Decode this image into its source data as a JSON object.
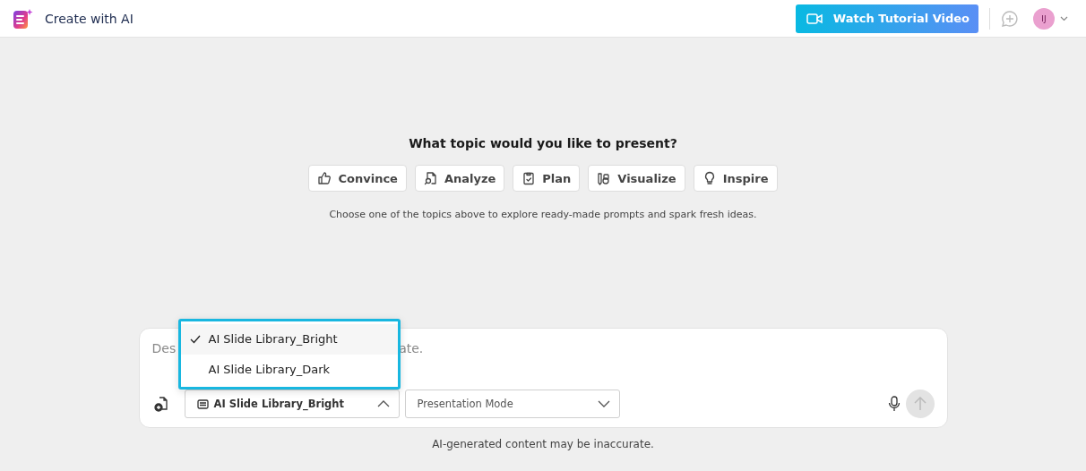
{
  "header": {
    "title": "Create with AI",
    "tutorial_button": "Watch Tutorial Video",
    "avatar": "IJ"
  },
  "heading": "What topic would you like to present?",
  "topics": [
    {
      "kind": "thumb",
      "label": "Convince"
    },
    {
      "kind": "analyze",
      "label": "Analyze"
    },
    {
      "kind": "clipboard",
      "label": "Plan"
    },
    {
      "kind": "visualize",
      "label": "Visualize"
    },
    {
      "kind": "bulb",
      "label": "Inspire"
    }
  ],
  "hint": "Choose one of the topics above to explore ready-made prompts and spark fresh ideas.",
  "prompt": {
    "placeholder_parts": [
      "Des",
      "ate."
    ]
  },
  "library_select": {
    "value": "AI Slide Library_Bright",
    "expanded": true,
    "options": [
      {
        "label": "AI Slide Library_Bright",
        "selected": true
      },
      {
        "label": "AI Slide Library_Dark",
        "selected": false
      }
    ]
  },
  "mode_select": {
    "placeholder": "Presentation Mode"
  },
  "disclaimer": "AI-generated content may be inaccurate."
}
